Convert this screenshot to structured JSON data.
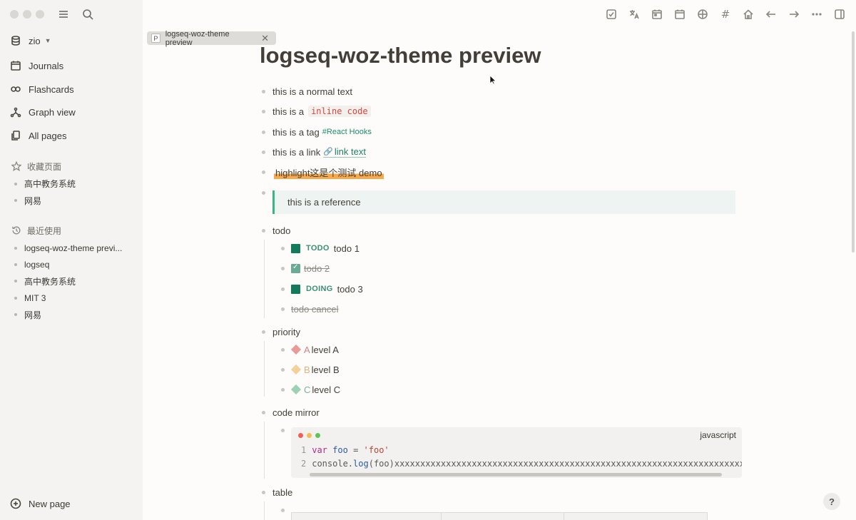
{
  "window": {
    "traffic_lights": [
      "#d9d7d4",
      "#d9d7d4",
      "#d9d7d4"
    ]
  },
  "sidebar": {
    "graph_name": "zio",
    "nav": [
      {
        "label": "Journals",
        "icon": "calendar-icon"
      },
      {
        "label": "Flashcards",
        "icon": "infinity-icon"
      },
      {
        "label": "Graph view",
        "icon": "graph-icon"
      },
      {
        "label": "All pages",
        "icon": "pages-icon"
      }
    ],
    "favorites": {
      "title": "收藏页面",
      "items": [
        "高中教务系统",
        "网易"
      ]
    },
    "recent": {
      "title": "最近使用",
      "items": [
        "logseq-woz-theme previ...",
        "logseq",
        "高中教务系统",
        "MIT 3",
        "网易"
      ]
    },
    "new_page": "New page"
  },
  "tab": {
    "badge": "P",
    "label": "logseq-woz-theme preview"
  },
  "page": {
    "title": "logseq-woz-theme preview",
    "blocks": {
      "normal": "this is a normal text",
      "inline_prefix": "this is a",
      "inline_code": "inline code",
      "tag_prefix": "this is a tag",
      "tag": "#React Hooks",
      "link_prefix": "this is a link",
      "link_text": "link text",
      "highlight": "highlight这是个测试 demo",
      "reference": "this is a reference",
      "todo_parent": "todo",
      "todo1_marker": "TODO",
      "todo1": "todo 1",
      "todo2": "todo 2",
      "todo3_marker": "DOING",
      "todo3": "todo 3",
      "todo_cancel": "todo cancel",
      "priority_parent": "priority",
      "prioA_letter": "A",
      "prioA": "level A",
      "prioB_letter": "B",
      "prioB": "level B",
      "prioC_letter": "C",
      "prioC": "level C",
      "code_parent": "code mirror",
      "code_lang": "javascript",
      "code_ln1": "1",
      "code_kw": "var",
      "code_var": "foo",
      "code_eq": " = ",
      "code_str": "'foo'",
      "code_ln2": "2",
      "code_line2_pre": "console.",
      "code_line2_fn": "log",
      "code_line2_rest": "(foo)xxxxxxxxxxxxxxxxxxxxxxxxxxxxxxxxxxxxxxxxxxxxxxxxxxxxxxxxxxxxxxxxxxxxxxxx",
      "table_parent": "table"
    },
    "colors": {
      "accent": "#137b5c",
      "highlight": "#f5a94a",
      "code_red": "#d9453d",
      "prio_a": "#e79a98",
      "prio_b": "#f3d199",
      "prio_c": "#9fcfb5"
    }
  },
  "help": "?"
}
